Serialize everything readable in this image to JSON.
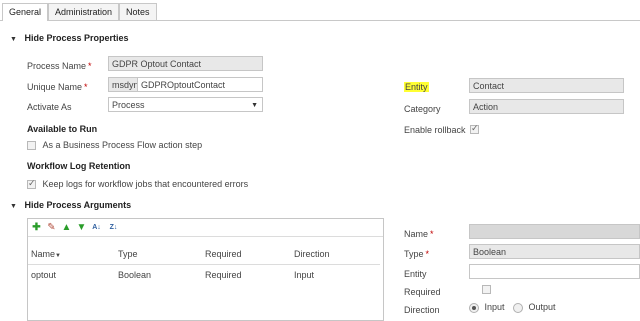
{
  "tabs": [
    {
      "label": "General"
    },
    {
      "label": "Administration"
    },
    {
      "label": "Notes"
    }
  ],
  "process_properties": {
    "section_title": "Hide Process Properties",
    "process_name_label": "Process Name",
    "process_name_value": "GDPR Optout Contact",
    "unique_name_label": "Unique Name",
    "unique_name_prefix": "msdyn_",
    "unique_name_value": "GDPROptoutContact",
    "activate_as_label": "Activate As",
    "activate_as_value": "Process",
    "available_to_run_title": "Available to Run",
    "business_process_flow_label": "As a Business Process Flow action step",
    "business_process_flow_checked": false,
    "workflow_log_title": "Workflow Log Retention",
    "keep_logs_label": "Keep logs for workflow jobs that encountered errors",
    "keep_logs_checked": true,
    "entity_label": "Entity",
    "entity_value": "Contact",
    "category_label": "Category",
    "category_value": "Action",
    "enable_rollback_label": "Enable rollback",
    "enable_rollback_checked": true,
    "highlight_color": "#ffff33"
  },
  "process_arguments": {
    "section_title": "Hide Process Arguments",
    "toolbar_icons": [
      "add-icon",
      "edit-icon",
      "move-up-icon",
      "move-down-icon",
      "sort-ascending-icon",
      "sort-descending-icon"
    ],
    "columns": [
      "Name",
      "Type",
      "Required",
      "Direction"
    ],
    "rows": [
      {
        "name": "optout",
        "type": "Boolean",
        "required": "Required",
        "direction": "Input"
      }
    ]
  },
  "argument_detail": {
    "name_label": "Name",
    "name_value": "",
    "type_label": "Type",
    "type_value": "Boolean",
    "entity_label": "Entity",
    "entity_value": "",
    "required_label": "Required",
    "required_checked": false,
    "direction_label": "Direction",
    "direction_options": [
      "Input",
      "Output"
    ],
    "direction_selected": "Input"
  }
}
